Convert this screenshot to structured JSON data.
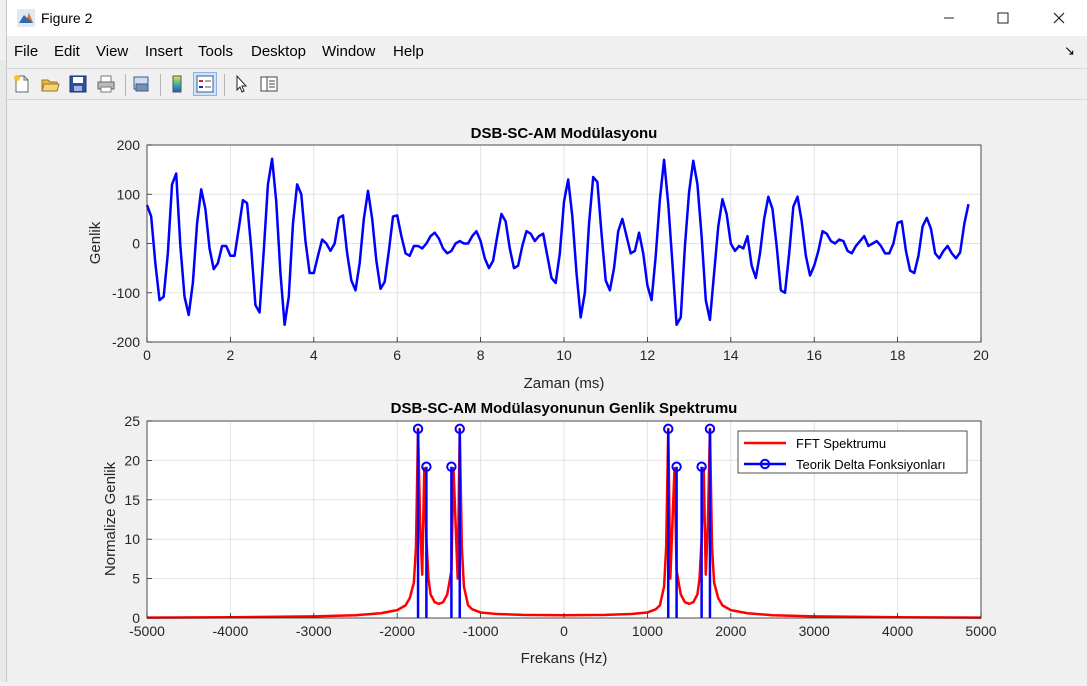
{
  "window": {
    "title": "Figure 2",
    "menu": [
      "File",
      "Edit",
      "View",
      "Insert",
      "Tools",
      "Desktop",
      "Window",
      "Help"
    ]
  },
  "toolbar": {
    "icons": [
      "new-figure-icon",
      "open-file-icon",
      "save-icon",
      "print-icon",
      "print-preview-icon",
      "colorbar-icon",
      "legend-icon",
      "pointer-icon",
      "property-inspector-icon"
    ]
  },
  "colors": {
    "signal": "#0000ff",
    "fft": "#ff0000",
    "delta": "#0000ff",
    "grid": "#e2e2e2"
  },
  "chart_data": [
    {
      "type": "line",
      "title": "DSB-SC-AM Modülasyonu",
      "xlabel": "Zaman (ms)",
      "ylabel": "Genlik",
      "xlim": [
        0,
        20
      ],
      "ylim": [
        -200,
        200
      ],
      "xticks": [
        0,
        2,
        4,
        6,
        8,
        10,
        12,
        14,
        16,
        18,
        20
      ],
      "yticks": [
        200,
        100,
        0,
        -100,
        -200
      ],
      "grid": true,
      "series": [
        {
          "color": "#0000ff",
          "x_start": 0,
          "x_step": 0.1,
          "values": [
            78,
            55,
            -40,
            -115,
            -108,
            -20,
            120,
            142,
            -5,
            -108,
            -145,
            -80,
            40,
            110,
            70,
            -10,
            -52,
            -40,
            -5,
            -5,
            -25,
            -25,
            30,
            88,
            82,
            -10,
            -125,
            -140,
            -15,
            120,
            172,
            85,
            -60,
            -165,
            -108,
            40,
            120,
            100,
            5,
            -60,
            -60,
            -25,
            8,
            0,
            -15,
            0,
            52,
            57,
            -20,
            -75,
            -95,
            -40,
            50,
            107,
            50,
            -35,
            -92,
            -78,
            -15,
            55,
            57,
            15,
            -20,
            -25,
            -5,
            -5,
            -10,
            0,
            15,
            22,
            10,
            -10,
            -20,
            -15,
            0,
            5,
            0,
            0,
            15,
            25,
            5,
            -30,
            -50,
            -35,
            15,
            60,
            45,
            -10,
            -50,
            -45,
            -5,
            25,
            20,
            5,
            15,
            20,
            -25,
            -70,
            -80,
            -20,
            85,
            130,
            55,
            -60,
            -150,
            -100,
            40,
            135,
            125,
            20,
            -75,
            -95,
            -50,
            25,
            50,
            15,
            -20,
            -15,
            22,
            -20,
            -85,
            -115,
            -25,
            90,
            170,
            80,
            -40,
            -165,
            -150,
            -5,
            105,
            168,
            120,
            15,
            -115,
            -155,
            -60,
            35,
            90,
            60,
            0,
            -15,
            -5,
            -10,
            15,
            -45,
            -70,
            -20,
            50,
            95,
            70,
            -5,
            -95,
            -100,
            -20,
            75,
            95,
            45,
            -25,
            -65,
            -45,
            -15,
            25,
            20,
            5,
            0,
            8,
            5,
            -15,
            -20,
            -5,
            5,
            15,
            -5,
            0,
            5,
            -5,
            -20,
            -20,
            0,
            42,
            45,
            -15,
            -55,
            -60,
            -25,
            35,
            52,
            30,
            -20,
            -30,
            -15,
            -5,
            -20,
            -30,
            -18,
            40,
            80
          ]
        }
      ]
    },
    {
      "type": "line",
      "title": "DSB-SC-AM Modülasyonunun Genlik Spektrumu",
      "xlabel": "Frekans (Hz)",
      "ylabel": "Normalize Genlik",
      "xlim": [
        -5000,
        5000
      ],
      "ylim": [
        0,
        25
      ],
      "xticks": [
        -5000,
        -4000,
        -3000,
        -2000,
        -1000,
        0,
        1000,
        2000,
        3000,
        4000,
        5000
      ],
      "yticks": [
        25,
        20,
        15,
        10,
        5,
        0
      ],
      "grid": true,
      "legend_position": "top-right",
      "series": [
        {
          "name": "FFT Spektrumu",
          "style": "line",
          "color": "#ff0000",
          "x": [
            -5000,
            -4000,
            -3000,
            -2500,
            -2200,
            -2000,
            -1900,
            -1850,
            -1800,
            -1775,
            -1750,
            -1725,
            -1700,
            -1675,
            -1650,
            -1625,
            -1600,
            -1550,
            -1500,
            -1450,
            -1400,
            -1350,
            -1325,
            -1300,
            -1275,
            -1250,
            -1225,
            -1200,
            -1150,
            -1100,
            -1000,
            -800,
            -500,
            0,
            500,
            800,
            1000,
            1100,
            1150,
            1200,
            1225,
            1250,
            1275,
            1300,
            1325,
            1350,
            1400,
            1450,
            1500,
            1550,
            1600,
            1625,
            1650,
            1675,
            1700,
            1725,
            1750,
            1775,
            1800,
            1850,
            1900,
            2000,
            2200,
            2500,
            3000,
            4000,
            5000
          ],
          "values": [
            0.05,
            0.1,
            0.2,
            0.35,
            0.6,
            1.0,
            1.6,
            2.5,
            4.5,
            9,
            24,
            12,
            5.5,
            19,
            10,
            5,
            3,
            2,
            1.8,
            2,
            3,
            6,
            19,
            12,
            5,
            24,
            9,
            4,
            1.6,
            1.1,
            0.7,
            0.5,
            0.4,
            0.35,
            0.4,
            0.5,
            0.7,
            1.1,
            1.6,
            4,
            9,
            24,
            5,
            12,
            19,
            6,
            3,
            2,
            1.8,
            2,
            3,
            5,
            10,
            19,
            5.5,
            12,
            24,
            9,
            4.5,
            2.5,
            1.6,
            1.0,
            0.6,
            0.35,
            0.2,
            0.1,
            0.05
          ]
        },
        {
          "name": "Teorik Delta Fonksiyonları",
          "style": "stem",
          "color": "#0000ff",
          "x": [
            -1750,
            -1650,
            -1350,
            -1250,
            1250,
            1350,
            1650,
            1750
          ],
          "values": [
            24,
            19.2,
            19.2,
            24,
            24,
            19.2,
            19.2,
            24
          ]
        }
      ]
    }
  ]
}
